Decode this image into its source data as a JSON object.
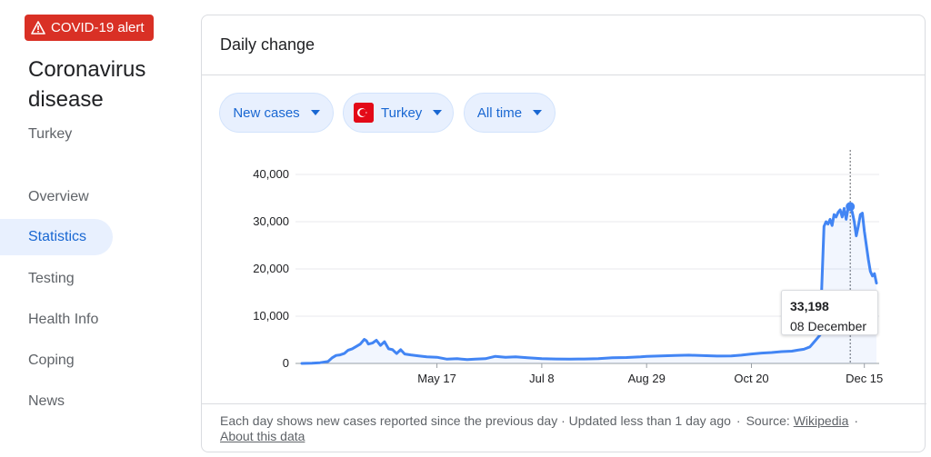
{
  "alert": {
    "label": "COVID-19 alert",
    "color": "#d93025"
  },
  "topic": {
    "title": "Coronavirus disease",
    "region": "Turkey"
  },
  "nav": {
    "items": [
      {
        "label": "Overview",
        "active": false
      },
      {
        "label": "Statistics",
        "active": true
      },
      {
        "label": "Testing",
        "active": false
      },
      {
        "label": "Health Info",
        "active": false
      },
      {
        "label": "Coping",
        "active": false
      },
      {
        "label": "News",
        "active": false
      }
    ]
  },
  "card": {
    "title": "Daily change",
    "filters": {
      "metric": "New cases",
      "location": "Turkey",
      "range": "All time"
    },
    "tooltip": {
      "value": "33,198",
      "date": "08 December"
    },
    "footer": {
      "text": "Each day shows new cases reported since the previous day · Updated less than 1 day ago",
      "source_label": "Source:",
      "source_link": "Wikipedia",
      "about_link": "About this data"
    }
  },
  "chart_data": {
    "type": "line",
    "title": "Daily change",
    "xlabel": "",
    "ylabel": "",
    "ylim": [
      0,
      40000
    ],
    "yticks": [
      0,
      10000,
      20000,
      30000,
      40000
    ],
    "ytick_labels": [
      "0",
      "10,000",
      "20,000",
      "30,000",
      "40,000"
    ],
    "xtick_labels": [
      "May 17",
      "Jul 8",
      "Aug 29",
      "Oct 20",
      "Dec 15"
    ],
    "grid": true,
    "line_color": "#4285f4",
    "highlight": {
      "x": "2020-12-08",
      "y": 33198
    },
    "series": [
      {
        "points": [
          [
            "2020-03-11",
            1
          ],
          [
            "2020-03-16",
            29
          ],
          [
            "2020-03-20",
            150
          ],
          [
            "2020-03-24",
            400
          ],
          [
            "2020-03-26",
            1200
          ],
          [
            "2020-03-28",
            1700
          ],
          [
            "2020-03-30",
            1800
          ],
          [
            "2020-04-01",
            2100
          ],
          [
            "2020-04-03",
            2800
          ],
          [
            "2020-04-05",
            3100
          ],
          [
            "2020-04-07",
            3600
          ],
          [
            "2020-04-09",
            4100
          ],
          [
            "2020-04-11",
            5100
          ],
          [
            "2020-04-12",
            4800
          ],
          [
            "2020-04-13",
            4100
          ],
          [
            "2020-04-15",
            4300
          ],
          [
            "2020-04-17",
            4900
          ],
          [
            "2020-04-19",
            3800
          ],
          [
            "2020-04-21",
            4600
          ],
          [
            "2020-04-23",
            3100
          ],
          [
            "2020-04-25",
            2900
          ],
          [
            "2020-04-27",
            2100
          ],
          [
            "2020-04-29",
            2900
          ],
          [
            "2020-05-01",
            2000
          ],
          [
            "2020-05-04",
            1800
          ],
          [
            "2020-05-08",
            1600
          ],
          [
            "2020-05-12",
            1400
          ],
          [
            "2020-05-17",
            1300
          ],
          [
            "2020-05-22",
            900
          ],
          [
            "2020-05-27",
            1000
          ],
          [
            "2020-06-01",
            800
          ],
          [
            "2020-06-05",
            900
          ],
          [
            "2020-06-10",
            1000
          ],
          [
            "2020-06-15",
            1500
          ],
          [
            "2020-06-20",
            1300
          ],
          [
            "2020-06-25",
            1400
          ],
          [
            "2020-07-01",
            1200
          ],
          [
            "2020-07-08",
            1000
          ],
          [
            "2020-07-15",
            950
          ],
          [
            "2020-07-22",
            930
          ],
          [
            "2020-07-29",
            950
          ],
          [
            "2020-08-05",
            1000
          ],
          [
            "2020-08-12",
            1200
          ],
          [
            "2020-08-19",
            1250
          ],
          [
            "2020-08-26",
            1400
          ],
          [
            "2020-08-29",
            1500
          ],
          [
            "2020-09-05",
            1600
          ],
          [
            "2020-09-12",
            1700
          ],
          [
            "2020-09-19",
            1750
          ],
          [
            "2020-09-26",
            1650
          ],
          [
            "2020-10-03",
            1550
          ],
          [
            "2020-10-10",
            1600
          ],
          [
            "2020-10-15",
            1750
          ],
          [
            "2020-10-20",
            2000
          ],
          [
            "2020-10-25",
            2200
          ],
          [
            "2020-10-30",
            2300
          ],
          [
            "2020-11-04",
            2500
          ],
          [
            "2020-11-09",
            2600
          ],
          [
            "2020-11-12",
            2800
          ],
          [
            "2020-11-15",
            3000
          ],
          [
            "2020-11-18",
            3500
          ],
          [
            "2020-11-21",
            5000
          ],
          [
            "2020-11-23",
            6000
          ],
          [
            "2020-11-25",
            29000
          ],
          [
            "2020-11-26",
            30000
          ],
          [
            "2020-11-27",
            29500
          ],
          [
            "2020-11-28",
            30500
          ],
          [
            "2020-11-29",
            29200
          ],
          [
            "2020-11-30",
            31500
          ],
          [
            "2020-12-01",
            31000
          ],
          [
            "2020-12-02",
            32000
          ],
          [
            "2020-12-03",
            32500
          ],
          [
            "2020-12-04",
            31000
          ],
          [
            "2020-12-05",
            32800
          ],
          [
            "2020-12-06",
            30500
          ],
          [
            "2020-12-07",
            33000
          ],
          [
            "2020-12-08",
            33198
          ],
          [
            "2020-12-09",
            32000
          ],
          [
            "2020-12-10",
            30000
          ],
          [
            "2020-12-11",
            27000
          ],
          [
            "2020-12-12",
            29000
          ],
          [
            "2020-12-13",
            31500
          ],
          [
            "2020-12-14",
            31800
          ],
          [
            "2020-12-15",
            28000
          ],
          [
            "2020-12-16",
            25000
          ],
          [
            "2020-12-17",
            22000
          ],
          [
            "2020-12-18",
            19500
          ],
          [
            "2020-12-19",
            18500
          ],
          [
            "2020-12-20",
            19000
          ],
          [
            "2020-12-21",
            17000
          ]
        ]
      }
    ]
  }
}
